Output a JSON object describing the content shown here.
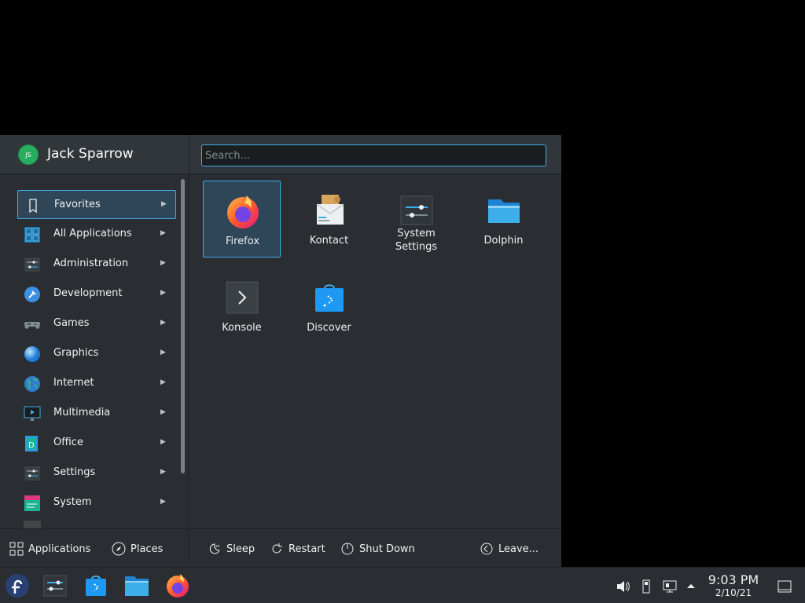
{
  "launcher": {
    "user": {
      "name": "Jack Sparrow",
      "initials": "JS"
    },
    "search": {
      "placeholder": "Search...",
      "value": ""
    },
    "categories": [
      {
        "label": "Favorites",
        "icon": "bookmark-icon",
        "selected": true
      },
      {
        "label": "All Applications",
        "icon": "grid-icon"
      },
      {
        "label": "Administration",
        "icon": "sliders-icon"
      },
      {
        "label": "Development",
        "icon": "hammer-icon"
      },
      {
        "label": "Games",
        "icon": "gamepad-icon"
      },
      {
        "label": "Graphics",
        "icon": "sphere-icon"
      },
      {
        "label": "Internet",
        "icon": "globe-icon"
      },
      {
        "label": "Multimedia",
        "icon": "monitor-play-icon"
      },
      {
        "label": "Office",
        "icon": "office-icon"
      },
      {
        "label": "Settings",
        "icon": "sliders-icon"
      },
      {
        "label": "System",
        "icon": "system-icon"
      }
    ],
    "favorites": [
      {
        "label": "Firefox",
        "icon": "firefox-icon",
        "selected": true
      },
      {
        "label": "Kontact",
        "icon": "kontact-icon"
      },
      {
        "label": "System Settings",
        "icon": "system-settings-icon"
      },
      {
        "label": "Dolphin",
        "icon": "folder-icon"
      },
      {
        "label": "Konsole",
        "icon": "terminal-icon"
      },
      {
        "label": "Discover",
        "icon": "store-icon"
      }
    ],
    "footer": {
      "applications_label": "Applications",
      "places_label": "Places",
      "sleep_label": "Sleep",
      "restart_label": "Restart",
      "shutdown_label": "Shut Down",
      "leave_label": "Leave..."
    }
  },
  "taskbar": {
    "items": [
      "fedora-launcher-icon",
      "system-settings-icon",
      "discover-icon",
      "dolphin-icon",
      "firefox-icon"
    ],
    "tray": [
      "volume-icon",
      "usb-icon",
      "network-icon",
      "chevron-up-icon"
    ],
    "clock": {
      "time": "9:03 PM",
      "date": "2/10/21"
    }
  },
  "colors": {
    "accent": "#3daee9",
    "panel": "#2a2e32",
    "header": "#31363b",
    "selection": "#2f4558"
  }
}
